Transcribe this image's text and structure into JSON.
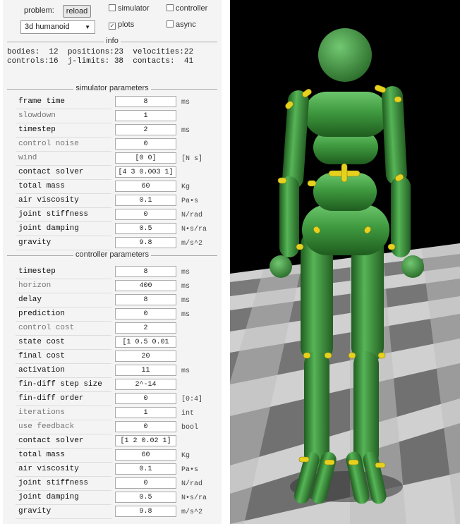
{
  "top": {
    "problem_label": "problem:",
    "reload_label": "reload",
    "model_select": "3d humanoid",
    "simulator_label": "simulator",
    "controller_label": "controller",
    "plots_label": "plots",
    "async_label": "async",
    "plots_checked": "✓"
  },
  "info": {
    "title": "info",
    "line1": "bodies:  12  positions:23  velocities:22",
    "line2": "controls:16  j-limits: 38  contacts:  41"
  },
  "simulator": {
    "title": "simulator parameters",
    "rows": [
      {
        "label": "frame time",
        "value": "8",
        "unit": "ms"
      },
      {
        "label": "slowdown",
        "value": "1",
        "unit": ""
      },
      {
        "label": "timestep",
        "value": "2",
        "unit": "ms"
      },
      {
        "label": "control noise",
        "value": "0",
        "unit": ""
      },
      {
        "label": "wind",
        "value": "[0 0]",
        "unit": "[N s]"
      },
      {
        "label": "contact solver",
        "value": "[4 3 0.003 1]",
        "unit": ""
      },
      {
        "label": "total mass",
        "value": "60",
        "unit": "Kg"
      },
      {
        "label": "air viscosity",
        "value": "0.1",
        "unit": "Pa•s"
      },
      {
        "label": "joint stiffness",
        "value": "0",
        "unit": "N/rad"
      },
      {
        "label": "joint damping",
        "value": "0.5",
        "unit": "N•s/ra"
      },
      {
        "label": "gravity",
        "value": "9.8",
        "unit": "m/s^2"
      }
    ]
  },
  "controller": {
    "title": "controller parameters",
    "rows": [
      {
        "label": "timestep",
        "value": "8",
        "unit": "ms"
      },
      {
        "label": "horizon",
        "value": "400",
        "unit": "ms"
      },
      {
        "label": "delay",
        "value": "8",
        "unit": "ms"
      },
      {
        "label": "prediction",
        "value": "0",
        "unit": "ms"
      },
      {
        "label": "control cost",
        "value": "2",
        "unit": ""
      },
      {
        "label": "state cost",
        "value": "[1 0.5 0.01",
        "unit": ""
      },
      {
        "label": "final cost",
        "value": "20",
        "unit": ""
      },
      {
        "label": "activation",
        "value": "11",
        "unit": "ms"
      },
      {
        "label": "fin-diff step size",
        "value": "2^-14",
        "unit": ""
      },
      {
        "label": "fin-diff order",
        "value": "0",
        "unit": "[0:4]"
      },
      {
        "label": "iterations",
        "value": "1",
        "unit": "int"
      },
      {
        "label": "use feedback",
        "value": "0",
        "unit": "bool"
      },
      {
        "label": "contact solver",
        "value": "[1 2 0.02 1]",
        "unit": ""
      },
      {
        "label": "total mass",
        "value": "60",
        "unit": "Kg"
      },
      {
        "label": "air viscosity",
        "value": "0.1",
        "unit": "Pa•s"
      },
      {
        "label": "joint stiffness",
        "value": "0",
        "unit": "N/rad"
      },
      {
        "label": "joint damping",
        "value": "0.5",
        "unit": "N•s/ra"
      },
      {
        "label": "gravity",
        "value": "9.8",
        "unit": "m/s^2"
      }
    ]
  },
  "colors": {
    "body_green": "#3f9a3f",
    "joint_yellow": "#e6d21e",
    "floor_light": "#cfcfcf",
    "floor_dark": "#6e6e6e"
  }
}
